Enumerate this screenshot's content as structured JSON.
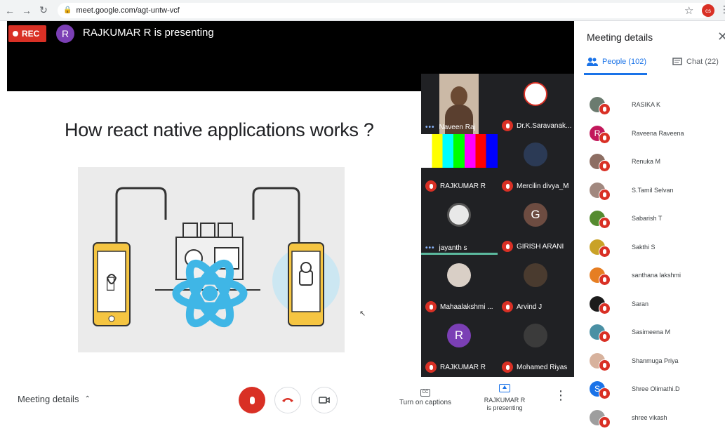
{
  "browser": {
    "url_host": "meet.google.com",
    "url_path": "/agt-untw-vcf",
    "profile_initials": "cs"
  },
  "presentation": {
    "rec_label": "REC",
    "presenter_initial": "R",
    "presenting_text": "RAJKUMAR R is presenting",
    "slide_title": "How react native applications works ?"
  },
  "grid": {
    "tiles": [
      {
        "name": "Naveen Raj",
        "speaking": true
      },
      {
        "name": "Dr.K.Saravanak...",
        "speaking": false
      },
      {
        "name": "RAJKUMAR R",
        "speaking": false
      },
      {
        "name": "Mercilin divya_M",
        "speaking": false
      },
      {
        "name": "jayanth s",
        "speaking": true
      },
      {
        "name": "GIRISH ARANI",
        "speaking": false,
        "initial": "G"
      },
      {
        "name": "Mahaalakshmi ...",
        "speaking": false
      },
      {
        "name": "Arvind J",
        "speaking": false
      },
      {
        "name": "RAJKUMAR R",
        "speaking": false,
        "initial": "R"
      },
      {
        "name": "Mohamed Riyas",
        "speaking": false
      }
    ]
  },
  "panel": {
    "title": "Meeting details",
    "people_tab": "People (102)",
    "chat_tab": "Chat (22)",
    "people": [
      {
        "name": "RASIKA K",
        "color": "#6b7b6f"
      },
      {
        "name": "Raveena Raveena",
        "color": "#c2185b",
        "initial": "R"
      },
      {
        "name": "Renuka M",
        "color": "#8d6e63"
      },
      {
        "name": "S.Tamil Selvan",
        "color": "#a1887f"
      },
      {
        "name": "Sabarish T",
        "color": "#558b2f"
      },
      {
        "name": "Sakthi S",
        "color": "#c9a227"
      },
      {
        "name": "santhana lakshmi",
        "color": "#e67e22"
      },
      {
        "name": "Saran",
        "color": "#1b1b1b"
      },
      {
        "name": "Sasimeena M",
        "color": "#4a90a4"
      },
      {
        "name": "Shanmuga Priya",
        "color": "#d7b29d"
      },
      {
        "name": "Shree Olimathi.D",
        "color": "#1a73e8",
        "initial": "S"
      },
      {
        "name": "shree vikash",
        "color": "#9e9e9e"
      }
    ]
  },
  "bottom": {
    "meeting_details": "Meeting details",
    "captions": "Turn on captions",
    "presenting_line1": "RAJKUMAR R",
    "presenting_line2": "is presenting"
  }
}
